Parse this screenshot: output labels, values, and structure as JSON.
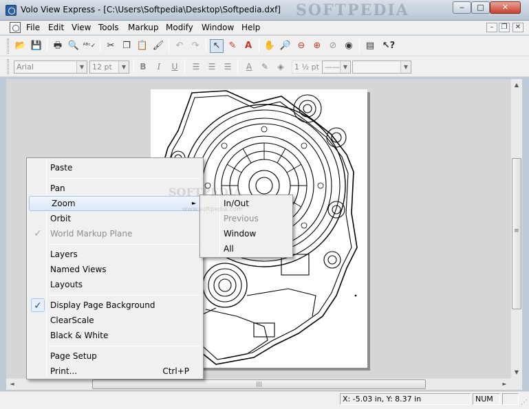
{
  "window": {
    "title": "Volo View Express - [C:\\Users\\Softpedia\\Desktop\\Softpedia.dxf]",
    "watermark": "SOFTPEDIA",
    "min_label": "‒",
    "max_label": "□",
    "close_label": "✕"
  },
  "menubar": {
    "items": [
      "File",
      "Edit",
      "View",
      "Tools",
      "Markup",
      "Modify",
      "Window",
      "Help"
    ],
    "mdi_min": "–",
    "mdi_restore": "❐",
    "mdi_close": "✕"
  },
  "toolbar_standard": {
    "icons": [
      "open-icon",
      "save-icon",
      "print-icon",
      "print-preview-icon",
      "spellcheck-icon",
      "cut-icon",
      "copy-icon",
      "paste-icon",
      "format-painter-icon",
      "undo-icon",
      "redo-icon",
      "select-arrow-icon",
      "markup-pen-icon",
      "markup-text-icon",
      "pan-icon",
      "zoom-icon",
      "zoom-window-icon",
      "zoom-extents-icon",
      "zoom-previous-icon",
      "orbit-icon",
      "properties-icon",
      "help-pointer-icon"
    ]
  },
  "toolbar_format": {
    "font_name": "Arial",
    "font_size": "12 pt",
    "bold": "B",
    "italic": "I",
    "underline": "U",
    "line_weight": "1 ½ pt",
    "line_style": "——",
    "color_value": ""
  },
  "context_menu": {
    "items": [
      {
        "label": "Paste",
        "enabled": true
      },
      {
        "label": "Pan",
        "enabled": true
      },
      {
        "label": "Zoom",
        "enabled": true,
        "submenu": true,
        "highlighted": true
      },
      {
        "label": "Orbit",
        "enabled": true
      },
      {
        "label": "World Markup Plane",
        "enabled": false,
        "checked": true
      },
      {
        "label": "Layers",
        "enabled": true
      },
      {
        "label": "Named Views",
        "enabled": true
      },
      {
        "label": "Layouts",
        "enabled": true
      },
      {
        "label": "Display Page Background",
        "enabled": true,
        "checked": true
      },
      {
        "label": "ClearScale",
        "enabled": true
      },
      {
        "label": "Black & White",
        "enabled": true
      },
      {
        "label": "Page Setup",
        "enabled": true
      },
      {
        "label": "Print...",
        "enabled": true,
        "shortcut": "Ctrl+P"
      }
    ],
    "check_glyph": "✓",
    "submenu_arrow": "►"
  },
  "zoom_submenu": {
    "items": [
      {
        "label": "In/Out",
        "enabled": true
      },
      {
        "label": "Previous",
        "enabled": false
      },
      {
        "label": "Window",
        "enabled": true
      },
      {
        "label": "All",
        "enabled": true
      }
    ]
  },
  "canvas_watermark": "SOFTPEDIA",
  "canvas_watermark_url": "www.softpedia.com",
  "statusbar": {
    "coords": "X: -5.03 in, Y: 8.37 in",
    "num": "NUM"
  },
  "scroll": {
    "up": "▲",
    "down": "▼",
    "left": "◄",
    "right": "►",
    "grip": "≡",
    "hgrip": "|||"
  }
}
